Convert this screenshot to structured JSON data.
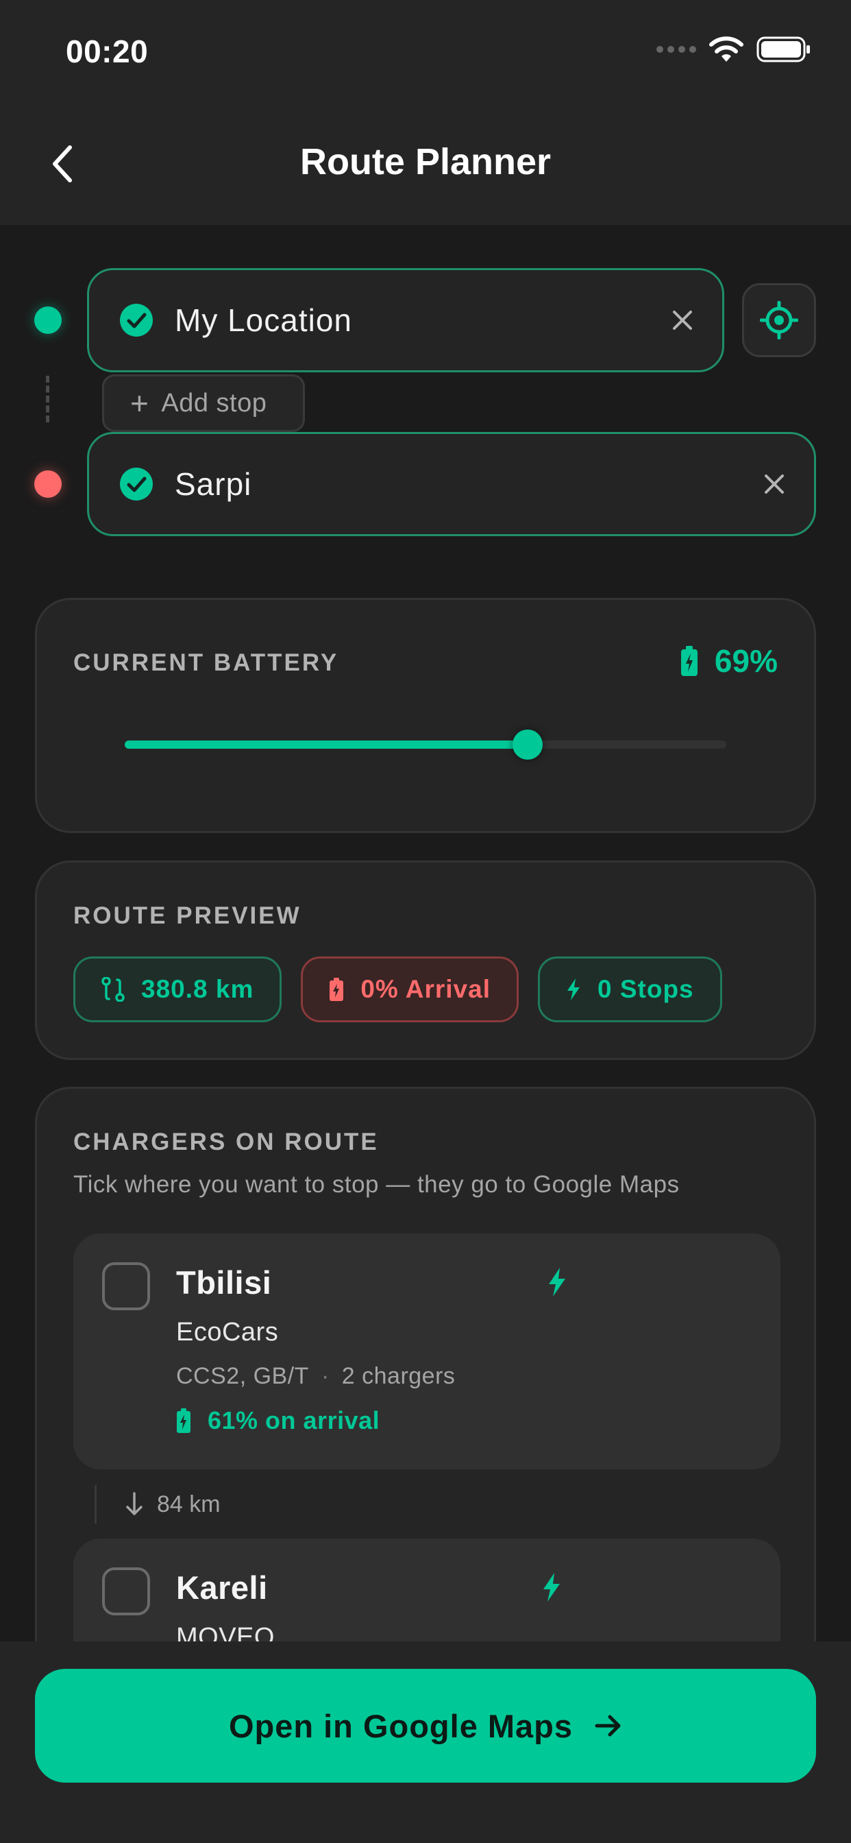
{
  "status_bar": {
    "time": "00:20"
  },
  "header": {
    "title": "Route Planner"
  },
  "route": {
    "origin": {
      "value": "My Location"
    },
    "destination": {
      "value": "Sarpi"
    },
    "add_stop_label": "Add stop"
  },
  "battery": {
    "label": "CURRENT BATTERY",
    "value_text": "69%",
    "level_percent": 67
  },
  "preview": {
    "label": "ROUTE PREVIEW",
    "chips": [
      {
        "icon": "route-icon",
        "text": "380.8 km"
      },
      {
        "icon": "battery-low-icon",
        "text": "0% Arrival"
      },
      {
        "icon": "bolt-icon",
        "text": "0 Stops"
      }
    ]
  },
  "chargers": {
    "label": "CHARGERS ON ROUTE",
    "subtitle": "Tick where you want to stop — they go to Google Maps",
    "items": [
      {
        "city": "Tbilisi",
        "operator": "EcoCars",
        "connectors": "CCS2, GB/T",
        "separator": "·",
        "count": "2 chargers",
        "arrival": "61% on arrival"
      },
      {
        "city": "Kareli",
        "operator": "MOVEO"
      }
    ],
    "legs": [
      {
        "distance": "84 km"
      }
    ]
  },
  "footer": {
    "cta_label": "Open in Google Maps"
  },
  "colors": {
    "accent": "#00c897",
    "danger": "#ff6b6b",
    "background": "#1b1b1b",
    "card": "#252525"
  }
}
